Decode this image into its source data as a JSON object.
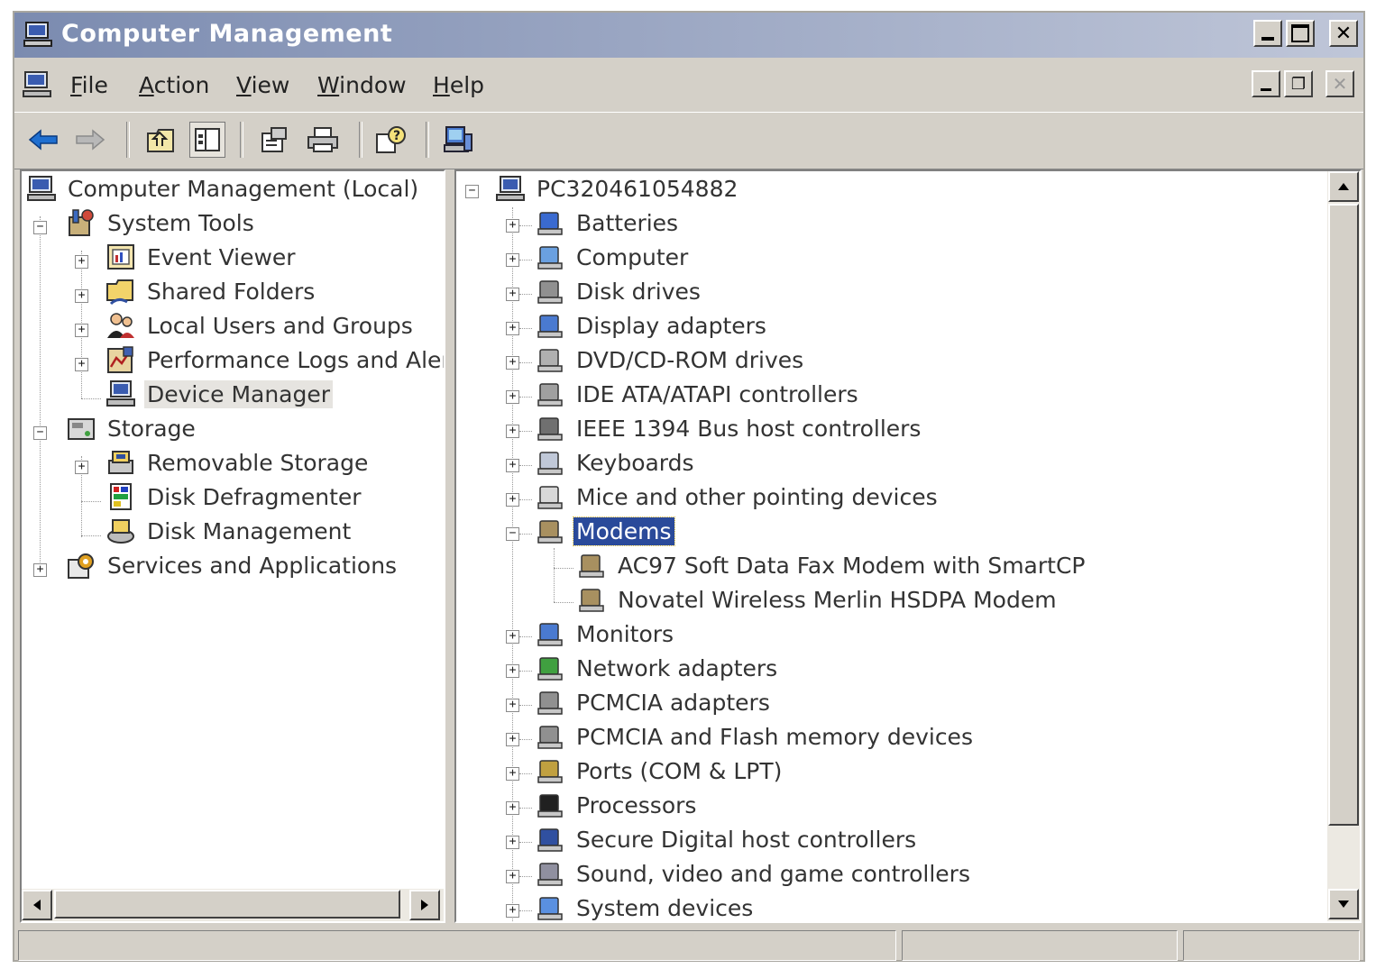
{
  "window": {
    "title": "Computer Management",
    "controls": [
      "minimize",
      "maximize",
      "close"
    ]
  },
  "menu": {
    "items": [
      {
        "label": "File",
        "u": "F",
        "rest": "ile"
      },
      {
        "label": "Action",
        "u": "A",
        "rest": "ction"
      },
      {
        "label": "View",
        "u": "V",
        "rest": "iew"
      },
      {
        "label": "Window",
        "u": "W",
        "rest": "indow"
      },
      {
        "label": "Help",
        "u": "H",
        "rest": "elp"
      }
    ]
  },
  "toolbar": {
    "buttons": [
      "back-icon",
      "forward-icon",
      "up-folder-icon",
      "show-hide-tree-icon",
      "properties-icon",
      "print-icon",
      "help-icon",
      "computer-icon"
    ]
  },
  "left_tree": {
    "root": "Computer Management (Local)",
    "system_tools": "System Tools",
    "event_viewer": "Event Viewer",
    "shared_folders": "Shared Folders",
    "local_users": "Local Users and Groups",
    "perf_logs": "Performance Logs and Alerts",
    "device_manager": "Device Manager",
    "storage": "Storage",
    "removable_storage": "Removable Storage",
    "disk_defrag": "Disk Defragmenter",
    "disk_mgmt": "Disk Management",
    "services_apps": "Services and Applications"
  },
  "right_tree": {
    "root": "PC320461054882",
    "categories": [
      {
        "label": "Batteries",
        "icon": "battery-icon"
      },
      {
        "label": "Computer",
        "icon": "computer-icon"
      },
      {
        "label": "Disk drives",
        "icon": "disk-drive-icon"
      },
      {
        "label": "Display adapters",
        "icon": "display-adapter-icon"
      },
      {
        "label": "DVD/CD-ROM drives",
        "icon": "cdrom-icon"
      },
      {
        "label": "IDE ATA/ATAPI controllers",
        "icon": "ide-controller-icon"
      },
      {
        "label": "IEEE 1394 Bus host controllers",
        "icon": "firewire-icon"
      },
      {
        "label": "Keyboards",
        "icon": "keyboard-icon"
      },
      {
        "label": "Mice and other pointing devices",
        "icon": "mouse-icon"
      },
      {
        "label": "Modems",
        "icon": "modem-icon",
        "expanded": true,
        "selected": true
      },
      {
        "label": "Monitors",
        "icon": "monitor-icon"
      },
      {
        "label": "Network adapters",
        "icon": "network-adapter-icon"
      },
      {
        "label": "PCMCIA adapters",
        "icon": "pcmcia-icon"
      },
      {
        "label": "PCMCIA and Flash memory devices",
        "icon": "flash-memory-icon"
      },
      {
        "label": "Ports (COM & LPT)",
        "icon": "port-icon"
      },
      {
        "label": "Processors",
        "icon": "processor-icon"
      },
      {
        "label": "Secure Digital host controllers",
        "icon": "sd-controller-icon"
      },
      {
        "label": "Sound, video and game controllers",
        "icon": "sound-icon"
      },
      {
        "label": "System devices",
        "icon": "system-device-icon"
      }
    ],
    "modem_children": [
      "AC97 Soft Data Fax Modem with SmartCP",
      "Novatel Wireless Merlin HSDPA Modem"
    ]
  },
  "colors": {
    "title_gradient_start": "#7b8bb0",
    "selection": "#2a4a9a",
    "chrome": "#d4d0c8"
  }
}
